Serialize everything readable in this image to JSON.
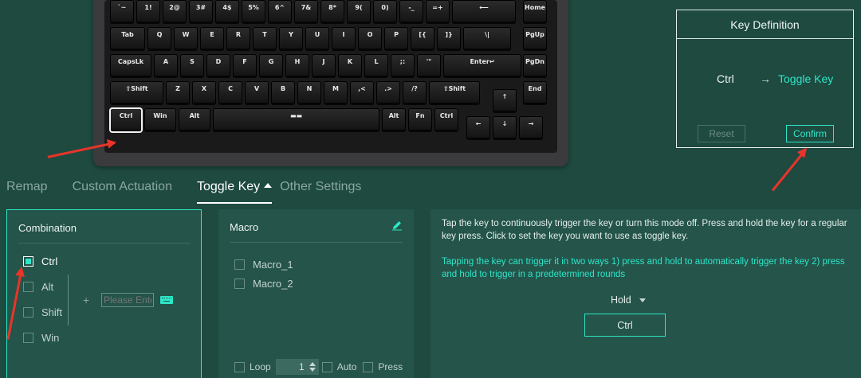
{
  "keyboard": {
    "rows": [
      [
        "`~",
        "1!",
        "2@",
        "3#",
        "4$",
        "5%",
        "6^",
        "7&",
        "8*",
        "9(",
        "0)",
        "-_",
        "=+",
        "⟵",
        "Home"
      ],
      [
        "Tab",
        "Q",
        "W",
        "E",
        "R",
        "T",
        "Y",
        "U",
        "I",
        "O",
        "P",
        "[{",
        "]}",
        "\\|",
        "PgUp"
      ],
      [
        "CapsLk",
        "A",
        "S",
        "D",
        "F",
        "G",
        "H",
        "J",
        "K",
        "L",
        ";:",
        "'\"",
        "Enter↵",
        "PgDn"
      ],
      [
        "⇧Shift",
        "Z",
        "X",
        "C",
        "V",
        "B",
        "N",
        "M",
        ",<",
        ".>",
        "/?",
        "⇧Shift",
        "↑",
        "End"
      ],
      [
        "Ctrl",
        "Win",
        "Alt",
        "▬▬",
        "Alt",
        "Fn",
        "Ctrl",
        "←",
        "↓",
        "→"
      ]
    ],
    "selected_key": "Ctrl"
  },
  "key_definition": {
    "title": "Key Definition",
    "from": "Ctrl",
    "arrow": "→",
    "to": "Toggle Key",
    "reset_label": "Reset",
    "confirm_label": "Confirm"
  },
  "tabs": [
    {
      "label": "Remap",
      "active": false
    },
    {
      "label": "Custom Actuation",
      "active": false
    },
    {
      "label": "Toggle Key",
      "active": true
    },
    {
      "label": "Other Settings",
      "active": false
    }
  ],
  "combination": {
    "title": "Combination",
    "items": [
      {
        "label": "Ctrl",
        "checked": true
      },
      {
        "label": "Alt",
        "checked": false
      },
      {
        "label": "Shift",
        "checked": false
      },
      {
        "label": "Win",
        "checked": false
      }
    ],
    "plus": "+",
    "input_placeholder": "Please Enter"
  },
  "macro": {
    "title": "Macro",
    "items": [
      {
        "label": "Macro_1",
        "checked": false
      },
      {
        "label": "Macro_2",
        "checked": false
      }
    ],
    "loop_label": "Loop",
    "loop_value": "1",
    "auto_label": "Auto",
    "press_label": "Press"
  },
  "info": {
    "description": "Tap the key to continuously trigger the key or turn this mode off. Press and hold the key for a regular key press. Click to set the key you want to use as toggle key.",
    "hint": "Tapping the key can trigger it in two ways 1) press and hold to automatically trigger the key 2) press and hold to trigger in a predetermined rounds",
    "mode_value": "Hold",
    "key_value": "Ctrl"
  },
  "colors": {
    "background": "#1e4a40",
    "panel": "#24544a",
    "accent": "#2ee6c8",
    "annotation": "#e9342a"
  }
}
